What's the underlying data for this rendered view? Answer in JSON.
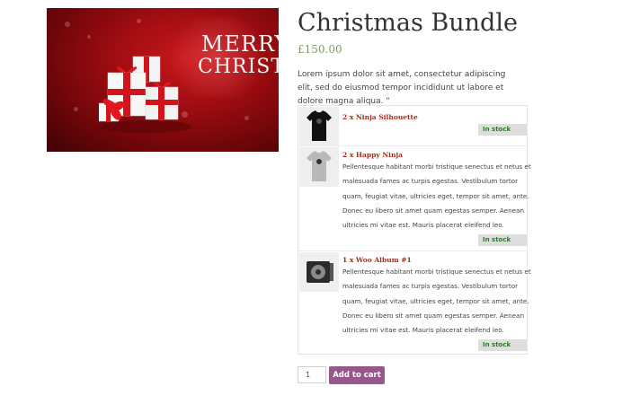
{
  "product": {
    "image": {
      "line1": "MERRY",
      "line2": "CHRISTMAS"
    },
    "title": "Christmas Bundle",
    "price": "£150.00",
    "description": "Lorem ipsum dolor sit amet, consectetur adipiscing elit, sed do eiusmod tempor incididunt ut labore et dolore magna aliqua. \""
  },
  "bundle_items": [
    {
      "title": "2 x Ninja Silhouette",
      "description": "",
      "stock": "In stock",
      "thumbnail_icon": "black-tshirt-icon"
    },
    {
      "title": "2 x Happy Ninja",
      "description": "Pellentesque habitant morbi tristique senectus et netus et malesuada fames ac turpis egestas. Vestibulum tortor quam, feugiat vitae, ultricies eget, tempor sit amet, ante. Donec eu libero sit amet quam egestas semper. Aenean ultricies mi vitae est. Mauris placerat eleifend leo.",
      "stock": "In stock",
      "thumbnail_icon": "grey-tshirt-icon"
    },
    {
      "title": "1 x Woo Album #1",
      "description": "Pellentesque habitant morbi tristique senectus et netus et malesuada fames ac turpis egestas. Vestibulum tortor quam, feugiat vitae, ultricies eget, tempor sit amet, ante. Donec eu libero sit amet quam egestas semper. Aenean ultricies mi vitae est. Mauris placerat eleifend leo.",
      "stock": "In stock",
      "thumbnail_icon": "album-icon"
    }
  ],
  "cart": {
    "quantity": "1",
    "add_label": "Add to cart"
  },
  "colors": {
    "button": "#96588a",
    "price": "#7f9a64",
    "item_title": "#a4301e",
    "stock_text": "#2d7a2a"
  }
}
